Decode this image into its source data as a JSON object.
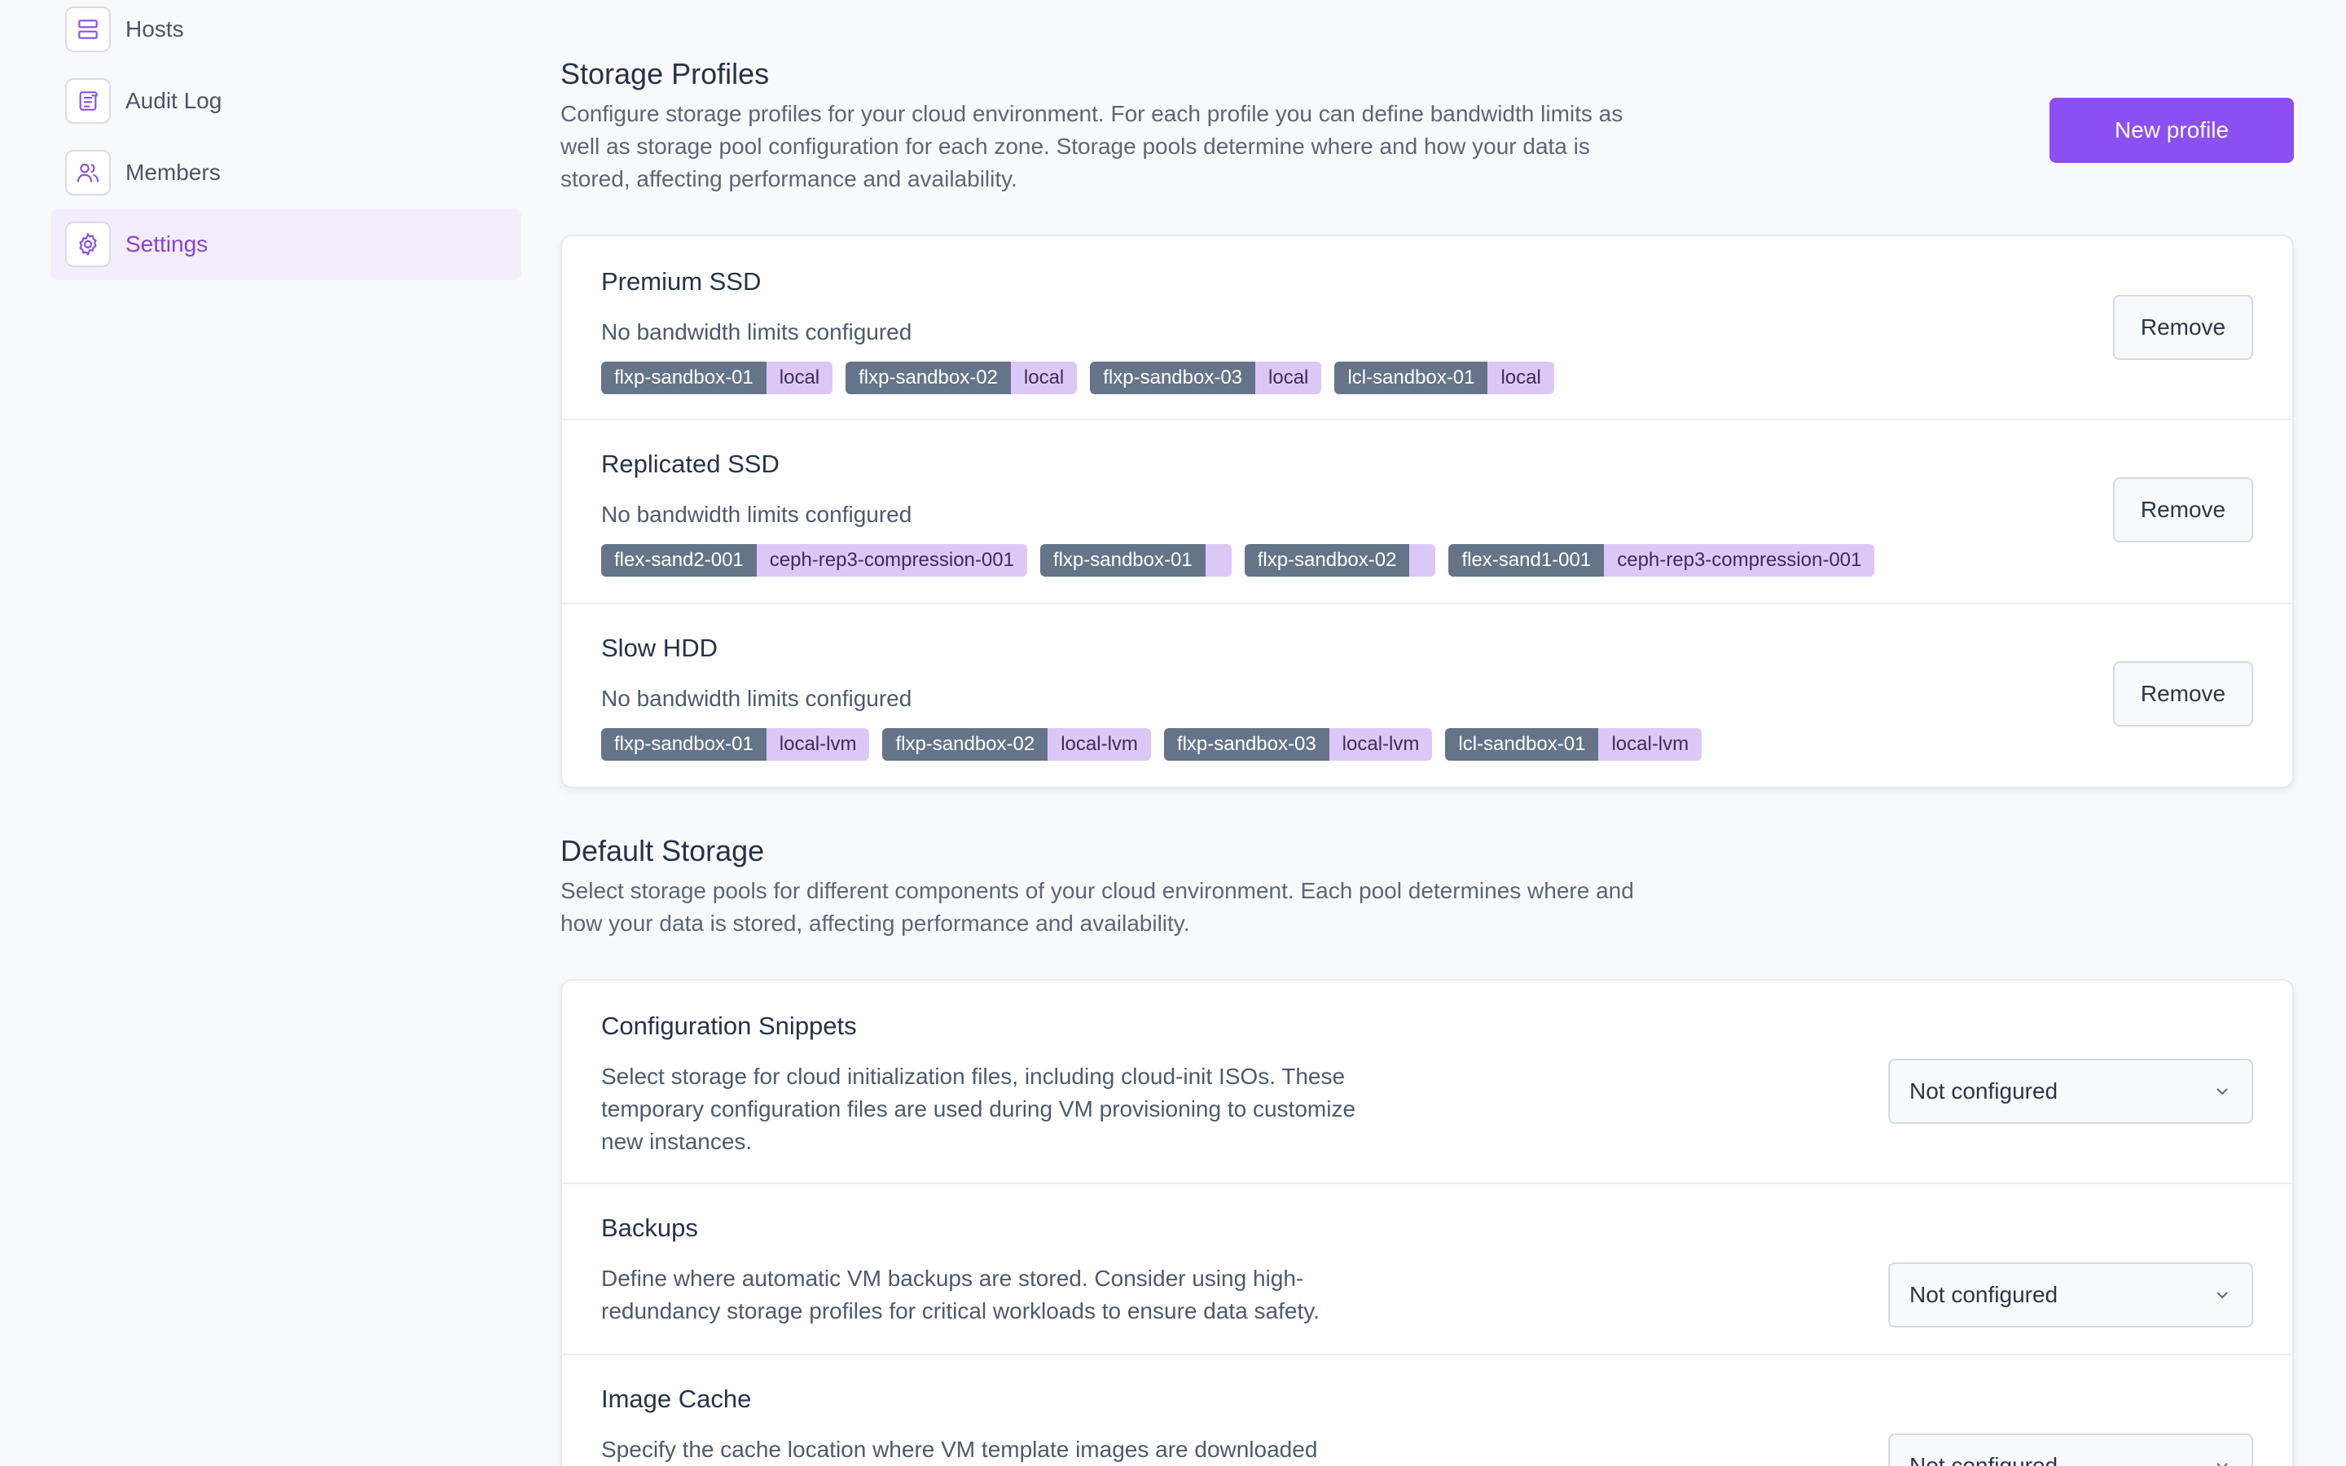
{
  "sidebar": {
    "items": [
      {
        "label": "Hosts",
        "icon": "server-icon"
      },
      {
        "label": "Audit Log",
        "icon": "scroll-icon"
      },
      {
        "label": "Members",
        "icon": "users-icon"
      },
      {
        "label": "Settings",
        "icon": "gear-icon",
        "active": true
      }
    ]
  },
  "storage_profiles": {
    "title": "Storage Profiles",
    "description": "Configure storage profiles for your cloud environment. For each profile you can define bandwidth limits as well as storage pool configuration for each zone. Storage pools determine where and how your data is stored, affecting performance and availability.",
    "new_button": "New profile",
    "remove_label": "Remove",
    "profiles": [
      {
        "name": "Premium SSD",
        "bandwidth": "No bandwidth limits configured",
        "tags": [
          {
            "host": "flxp-sandbox-01",
            "pool": "local"
          },
          {
            "host": "flxp-sandbox-02",
            "pool": "local"
          },
          {
            "host": "flxp-sandbox-03",
            "pool": "local"
          },
          {
            "host": "lcl-sandbox-01",
            "pool": "local"
          }
        ]
      },
      {
        "name": "Replicated SSD",
        "bandwidth": "No bandwidth limits configured",
        "tags": [
          {
            "host": "flex-sand2-001",
            "pool": "ceph-rep3-compression-001"
          },
          {
            "host": "flxp-sandbox-01",
            "pool": ""
          },
          {
            "host": "flxp-sandbox-02",
            "pool": ""
          },
          {
            "host": "flex-sand1-001",
            "pool": "ceph-rep3-compression-001"
          }
        ]
      },
      {
        "name": "Slow HDD",
        "bandwidth": "No bandwidth limits configured",
        "tags": [
          {
            "host": "flxp-sandbox-01",
            "pool": "local-lvm"
          },
          {
            "host": "flxp-sandbox-02",
            "pool": "local-lvm"
          },
          {
            "host": "flxp-sandbox-03",
            "pool": "local-lvm"
          },
          {
            "host": "lcl-sandbox-01",
            "pool": "local-lvm"
          }
        ]
      }
    ]
  },
  "default_storage": {
    "title": "Default Storage",
    "description": "Select storage pools for different components of your cloud environment. Each pool determines where and how your data is stored, affecting performance and availability.",
    "items": [
      {
        "name": "Configuration Snippets",
        "description": "Select storage for cloud initialization files, including cloud-init ISOs. These temporary configuration files are used during VM provisioning to customize new instances.",
        "value": "Not configured"
      },
      {
        "name": "Backups",
        "description": "Define where automatic VM backups are stored. Consider using high-redundancy storage profiles for critical workloads to ensure data safety.",
        "value": "Not configured"
      },
      {
        "name": "Image Cache",
        "description": "Specify the cache location where VM template images are downloaded",
        "value": "Not configured"
      }
    ]
  },
  "colors": {
    "accent": "#8b4ff2",
    "active_nav_bg": "#f2eefb",
    "tag_host": "#667489",
    "tag_pool": "#dcc8f7"
  }
}
